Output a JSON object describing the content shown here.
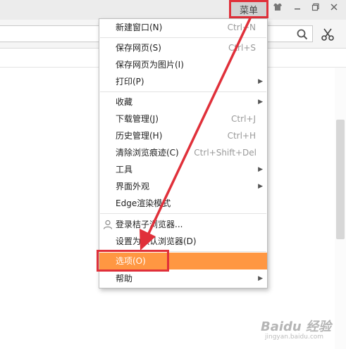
{
  "titlebar": {
    "menu_label": "菜单"
  },
  "menu": {
    "items": [
      {
        "label": "新建窗口(N)",
        "shortcut": "Ctrl+N"
      },
      {
        "label": "保存网页(S)",
        "shortcut": "Ctrl+S"
      },
      {
        "label": "保存网页为图片(I)",
        "shortcut": ""
      },
      {
        "label": "打印(P)",
        "shortcut": ""
      },
      {
        "label": "收藏",
        "shortcut": ""
      },
      {
        "label": "下载管理(J)",
        "shortcut": "Ctrl+J"
      },
      {
        "label": "历史管理(H)",
        "shortcut": "Ctrl+H"
      },
      {
        "label": "清除浏览痕迹(C)",
        "shortcut": "Ctrl+Shift+Del"
      },
      {
        "label": "工具",
        "shortcut": ""
      },
      {
        "label": "界面外观",
        "shortcut": ""
      },
      {
        "label": "Edge渲染模式",
        "shortcut": ""
      },
      {
        "label": "登录桔子浏览器...",
        "shortcut": ""
      },
      {
        "label": "设置为默认浏览器(D)",
        "shortcut": ""
      },
      {
        "label": "选项(O)",
        "shortcut": ""
      },
      {
        "label": "帮助",
        "shortcut": ""
      }
    ]
  },
  "icons": {
    "search": "search-icon",
    "scissors": "scissors-icon",
    "user": "user-icon"
  },
  "watermark": {
    "brand": "Baidu 经验",
    "url": "jingyan.baidu.com"
  },
  "colors": {
    "highlight": "#ff9742",
    "annotation": "#e0303a"
  }
}
